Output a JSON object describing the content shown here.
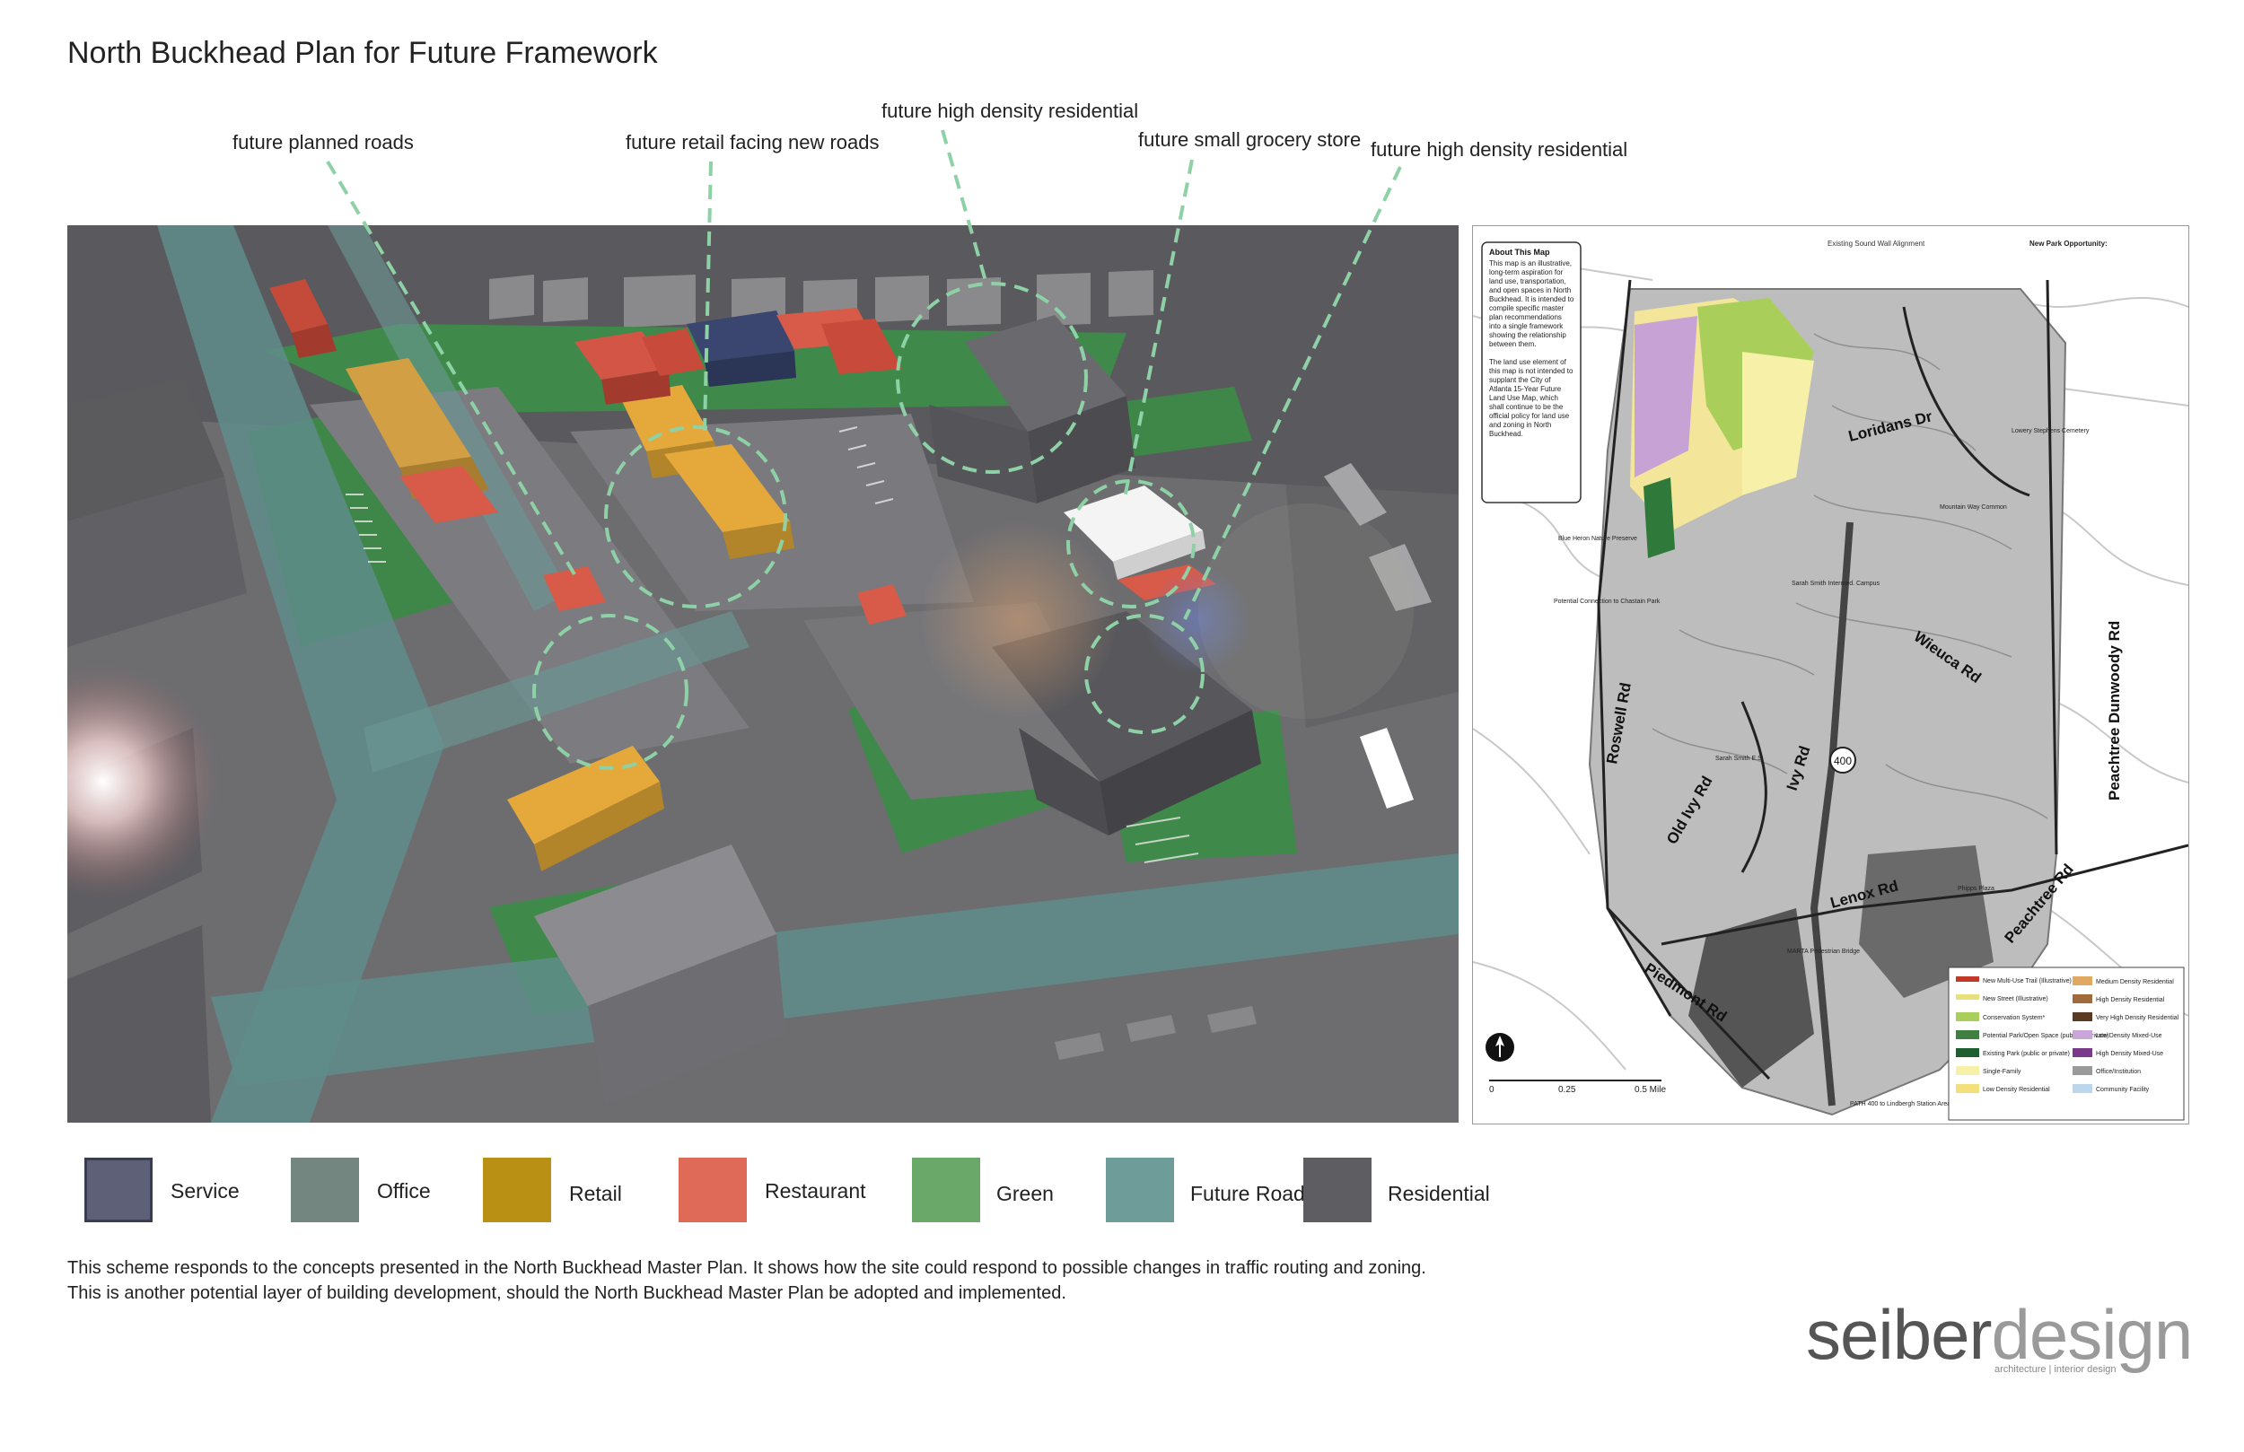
{
  "title": "North Buckhead Plan for Future Framework",
  "callouts": [
    {
      "id": "roads",
      "text": "future planned roads"
    },
    {
      "id": "retail",
      "text": "future retail facing new roads"
    },
    {
      "id": "hd1",
      "text": "future high density residential"
    },
    {
      "id": "grocery",
      "text": "future small grocery store"
    },
    {
      "id": "hd2",
      "text": "future high density residential"
    }
  ],
  "legend": [
    {
      "label": "Service",
      "color": "#5e6078"
    },
    {
      "label": "Office",
      "color": "#748680"
    },
    {
      "label": "Retail",
      "color": "#b98f14"
    },
    {
      "label": "Restaurant",
      "color": "#e06a58"
    },
    {
      "label": "Green",
      "color": "#6aa86a"
    },
    {
      "label": "Future Roads",
      "color": "#6e9c98"
    },
    {
      "label": "Residential",
      "color": "#5d5d62"
    }
  ],
  "description": [
    "This scheme responds to the concepts presented in the North Buckhead Master Plan. It shows how the site could respond to possible changes in traffic routing and zoning.",
    "This is another potential layer of building development, should the North Buckhead Master Plan be adopted and implemented."
  ],
  "brand": {
    "part1": "seiber",
    "part2": "design",
    "tagline": "architecture | interior design"
  },
  "map": {
    "about_title": "About This Map",
    "about_lines": [
      "This map is an illustrative,",
      "long-term aspiration for",
      "land use, transportation,",
      "and open spaces in North",
      "Buckhead. It is intended to",
      "compile specific master",
      "plan recommendations",
      "into a single framework",
      "showing the relationship",
      "between them.",
      "",
      "The land use element of",
      "this map is not intended to",
      "supplant the City of",
      "Atlanta 15-Year Future",
      "Land Use Map, which",
      "shall continue to be the",
      "official policy for land use",
      "and zoning in North",
      "Buckhead."
    ],
    "roads": {
      "loridans": "Loridans Dr",
      "wieuca": "Wieuca Rd",
      "roswell": "Roswell Rd",
      "peachtree_dunwoody": "Peachtree Dunwoody Rd",
      "old_ivy": "Old Ivy Rd",
      "ivy": "Ivy Rd",
      "lenox": "Lenox Rd",
      "peachtree": "Peachtree Rd",
      "piedmont": "Piedmont Rd",
      "ga400": "400"
    },
    "place_labels": {
      "sound_wall": "Existing Sound Wall Alignment",
      "new_park": "New Park Opportunity:",
      "blue_heron": "Blue Heron Nature Preserve",
      "chastain": "Potential Connection to Chastain Park",
      "sarah_smith": "Sarah Smith Intermed. Campus",
      "sarah_smith_es": "Sarah Smith E.S.",
      "lowery": "Lowery Stephens Cemetery",
      "mountain_way": "Mountain Way Common",
      "marta": "MARTA Pedestrian Bridge",
      "path400": "PATH 400 to Lindbergh Station Area",
      "phipps": "Phipps Plaza"
    },
    "scale": {
      "zero": "0",
      "quarter": "0.25",
      "half": "0.5 Mile"
    },
    "legend_left": [
      {
        "label": "New Multi-Use Trail (Illustrative)",
        "color": "#c0392b"
      },
      {
        "label": "New Street (Illustrative)",
        "color": "#e8e07a"
      },
      {
        "label": "Conservation System*",
        "color": "#a9cf5a"
      },
      {
        "label": "Potential Park/Open Space (public or private)",
        "color": "#3f7f3f"
      },
      {
        "label": "Existing Park (public or private)",
        "color": "#1f5f2f"
      },
      {
        "label": "Single-Family",
        "color": "#f6f0a8"
      },
      {
        "label": "Low Density Residential",
        "color": "#f3e07a"
      }
    ],
    "legend_right": [
      {
        "label": "Medium Density Residential",
        "color": "#e0a860"
      },
      {
        "label": "High Density Residential",
        "color": "#a06a3a"
      },
      {
        "label": "Very High Density Residential",
        "color": "#5a3a22"
      },
      {
        "label": "Low Density Mixed-Use",
        "color": "#c9a6d8"
      },
      {
        "label": "High Density Mixed-Use",
        "color": "#7a3a8a"
      },
      {
        "label": "Office/Institution",
        "color": "#9a9a9a"
      },
      {
        "label": "Community Facility",
        "color": "#bcd6ee"
      }
    ]
  }
}
